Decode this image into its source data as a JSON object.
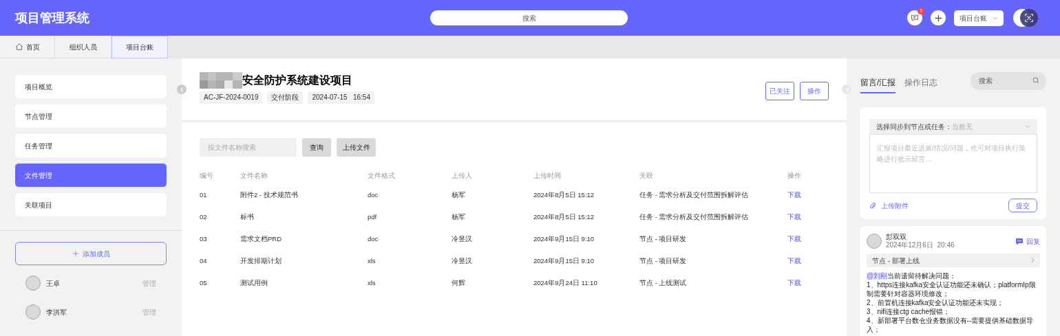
{
  "header": {
    "title": "项目管理系统",
    "search": {
      "placeholder": "搜索"
    },
    "notification_count": "3",
    "dropdown": "项目台账"
  },
  "tabs": [
    {
      "label": "首页",
      "kind": "home",
      "selected": false
    },
    {
      "label": "组织人员",
      "kind": "plain",
      "selected": false
    },
    {
      "label": "项目台账",
      "kind": "plain",
      "selected": true
    }
  ],
  "sidebar": {
    "menu": [
      {
        "label": "项目概览",
        "selected": false
      },
      {
        "label": "节点管理",
        "selected": false
      },
      {
        "label": "任务管理",
        "selected": false
      },
      {
        "label": "文件管理",
        "selected": true
      },
      {
        "label": "关联项目",
        "selected": false
      }
    ],
    "add_member_button": "添加成员",
    "members": [
      {
        "name": "王卓",
        "role": "管理"
      },
      {
        "name": "李洪军",
        "role": "管理"
      }
    ]
  },
  "project": {
    "title": "安全防护系统建设项目",
    "tags": [
      "AC-JF-2024-0019",
      "交付阶段",
      "2024-07-15   16:54"
    ],
    "buttons": [
      "已关注",
      "操作"
    ]
  },
  "files": {
    "search": {
      "placeholder": "按文件名称搜索"
    },
    "buttons": [
      "查询",
      "上传文件"
    ],
    "table": {
      "columns": [
        "编号",
        "文件名称",
        "文件格式",
        "上传人",
        "上传时间",
        "关联",
        "操作"
      ],
      "rows": [
        [
          "01",
          "附件2 - 技术规范书",
          "doc",
          "杨军",
          "2024年8月5日 15:12",
          "任务 - 需求分析及交付范围拆解评估",
          "下载"
        ],
        [
          "02",
          "标书",
          "pdf",
          "杨军",
          "2024年8月5日 15:12",
          "任务 - 需求分析及交付范围拆解评估",
          "下载"
        ],
        [
          "03",
          "需求文档PRD",
          "doc",
          "冷昱汉",
          "2024年9月15日 9:10",
          "节点 - 项目研发",
          "下载"
        ],
        [
          "04",
          "开发排期计划",
          "xls",
          "冷昱汉",
          "2024年9月15日 9:10",
          "节点 - 项目研发",
          "下载"
        ],
        [
          "05",
          "测试用例",
          "xls",
          "何辉",
          "2024年9月24日 11:10",
          "节点 - 上线测试",
          "下载"
        ]
      ]
    }
  },
  "right_panel": {
    "tabs": [
      {
        "label": "留言/汇报",
        "selected": true
      },
      {
        "label": "操作日志",
        "selected": false
      }
    ],
    "search": {
      "placeholder": "搜索"
    },
    "composer": {
      "sync_label": "选择同步到节点或任务：",
      "sync_value": "当前无",
      "placeholder": "汇报项目最近进展/情况/问题，也可对项目执行策略进行批示留言…",
      "attach": "上传附件",
      "submit": "提交"
    },
    "comments": [
      {
        "author": "彭双双",
        "time": "2024年12月6日  20:46",
        "reply": "回复",
        "node": "节点 - 部署上线",
        "mention": "@刘刚",
        "intro": "当前遗留待解决问题：",
        "lines": [
          "1、https连接kafka安全认证功能还未确认；platformIp限制需要针对容器环境修改；",
          "2、前置机连接kafka安全认证功能还未实现；",
          "3、nifi连接ctg cache报错；",
          "4、新部署平台数仓业务数据没有--需要提供基础数据导入；"
        ]
      }
    ]
  }
}
